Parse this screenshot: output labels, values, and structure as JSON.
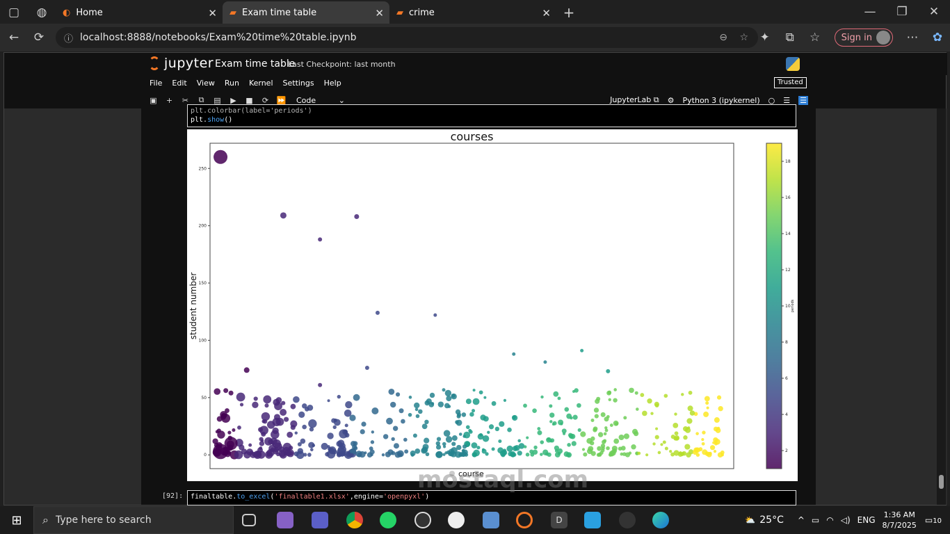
{
  "browser": {
    "tabs": [
      {
        "label": "Home",
        "active": false
      },
      {
        "label": "Exam time table",
        "active": true
      },
      {
        "label": "crime",
        "active": false
      }
    ],
    "url": "localhost:8888/notebooks/Exam%20time%20table.ipynb",
    "signin_label": "Sign in"
  },
  "jupyter": {
    "logo_text": "jupyter",
    "notebook_title": "Exam time table",
    "checkpoint": "Last Checkpoint: last month",
    "menu": [
      "File",
      "Edit",
      "View",
      "Run",
      "Kernel",
      "Settings",
      "Help"
    ],
    "trusted_label": "Trusted",
    "cell_type": "Code",
    "jupyterlab_label": "JupyterLab",
    "kernel_label": "Python 3 (ipykernel)"
  },
  "cells": {
    "prev_cell_line1": "plt.colorbar(label='periods')",
    "prev_cell_line2_a": "plt.",
    "prev_cell_line2_b": "show",
    "prev_cell_line2_c": "()",
    "next_prompt": "[92]:",
    "next_code_a": "finaltable.",
    "next_code_b": "to_excel",
    "next_code_c": "(",
    "next_code_d": "'finaltable1.xlsx'",
    "next_code_e": ",engine=",
    "next_code_f": "'openpyxl'",
    "next_code_g": ")"
  },
  "chart_data": {
    "type": "scatter",
    "title": "courses",
    "xlabel": "",
    "ylabel": "student number",
    "legend_label": "course",
    "colorbar_label": "periods",
    "ylim": [
      -12,
      272
    ],
    "yticks": [
      0,
      50,
      100,
      150,
      200,
      250
    ],
    "colorbar_range": [
      1,
      19
    ],
    "colorbar_ticks": [
      2,
      4,
      6,
      8,
      10,
      12,
      14,
      16,
      18
    ],
    "colormap": "viridis",
    "points": [
      {
        "x": 2,
        "y": 260,
        "period": 1,
        "size": 20
      },
      {
        "x": 14,
        "y": 209,
        "period": 2,
        "size": 9
      },
      {
        "x": 21,
        "y": 188,
        "period": 3,
        "size": 6
      },
      {
        "x": 28,
        "y": 208,
        "period": 3,
        "size": 7
      },
      {
        "x": 32,
        "y": 124,
        "period": 4,
        "size": 6
      },
      {
        "x": 43,
        "y": 122,
        "period": 5,
        "size": 5
      },
      {
        "x": 7,
        "y": 74,
        "period": 1,
        "size": 8
      },
      {
        "x": 30,
        "y": 76,
        "period": 4,
        "size": 6
      },
      {
        "x": 21,
        "y": 61,
        "period": 3,
        "size": 6
      },
      {
        "x": 58,
        "y": 88,
        "period": 8,
        "size": 5
      },
      {
        "x": 71,
        "y": 91,
        "period": 10,
        "size": 5
      },
      {
        "x": 76,
        "y": 73,
        "period": 11,
        "size": 6
      },
      {
        "x": 64,
        "y": 81,
        "period": 9,
        "size": 5
      },
      {
        "x": 4,
        "y": 54,
        "period": 1,
        "size": 7
      },
      {
        "x": 3,
        "y": 32,
        "period": 1,
        "size": 13
      },
      {
        "x": 2,
        "y": 3,
        "period": 1,
        "size": 22
      },
      {
        "x": 4,
        "y": 10,
        "period": 1,
        "size": 19
      }
    ]
  },
  "taskbar": {
    "search_placeholder": "Type here to search",
    "weather": "25°C",
    "language": "ENG",
    "time": "1:36 AM",
    "date": "8/7/2025",
    "notification_count": "10"
  },
  "watermark": "mostaql.com",
  "colors": {
    "accent_orange": "#f37726",
    "code_function": "#4ea3f3",
    "code_string": "#f08080"
  }
}
